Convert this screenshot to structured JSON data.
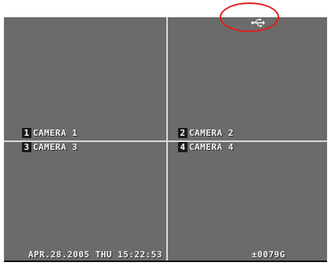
{
  "cameras": [
    {
      "number": "1",
      "name": "CAMERA 1"
    },
    {
      "number": "2",
      "name": "CAMERA 2"
    },
    {
      "number": "3",
      "name": "CAMERA 3"
    },
    {
      "number": "4",
      "name": "CAMERA 4"
    }
  ],
  "status": {
    "datetime": "APR.28.2005 THU 15:22:53",
    "counter": "±0079G"
  },
  "icons": {
    "top_right": "usb-icon",
    "annotation": "red-ellipse-highlight"
  },
  "colors": {
    "screen_bg": "#6b6b6b",
    "grid_line": "#d9d9d9",
    "text": "#f2f2f2",
    "annotation": "#e41c1c"
  }
}
